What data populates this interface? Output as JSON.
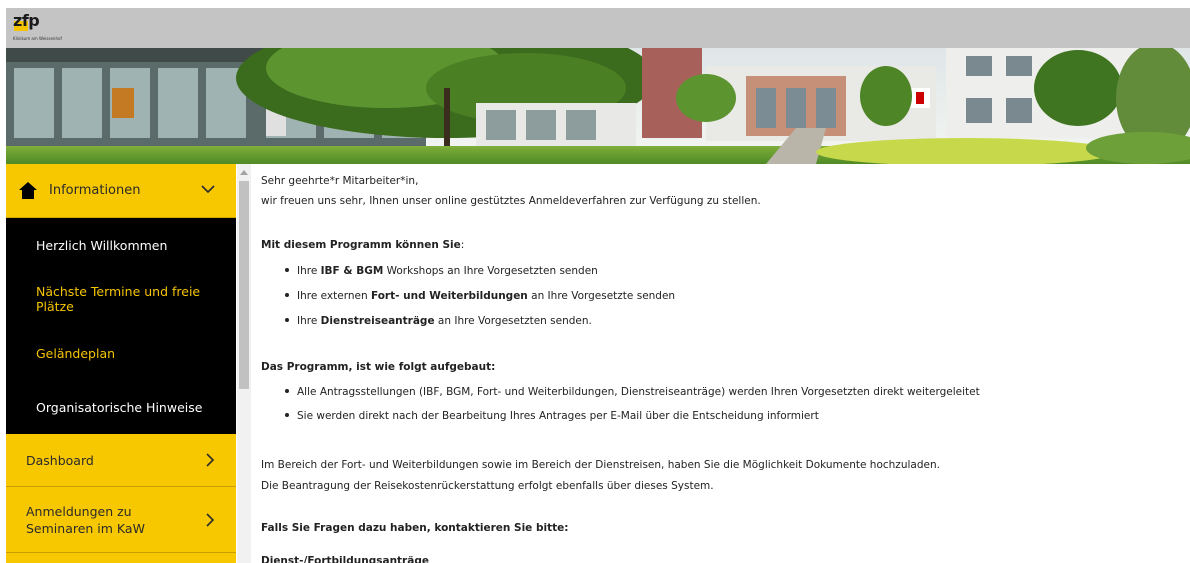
{
  "header": {
    "logo_text": "zfp",
    "logo_subtitle": "Klinikum am Weissenhof"
  },
  "sidebar": {
    "top": {
      "label": "Informationen",
      "icon": "home-icon",
      "chevron": "chevron-down-icon"
    },
    "sub_items": [
      {
        "label": "Herzlich Willkommen",
        "color": "#ffffff"
      },
      {
        "label": "Nächste Termine und freie Plätze",
        "color": "#f5c400"
      },
      {
        "label": "Geländeplan",
        "color": "#f5c400"
      },
      {
        "label": "Organisatorische Hinweise",
        "color": "#ffffff"
      }
    ],
    "items": [
      {
        "label": "Dashboard",
        "chevron": "chevron-right-icon"
      },
      {
        "label": "Anmeldungen zu Seminaren im KaW",
        "chevron": "chevron-right-icon"
      }
    ]
  },
  "content": {
    "greeting": "Sehr geehrte*r Mitarbeiter*in,",
    "intro": "wir freuen uns sehr, Ihnen unser online gestütztes Anmeldeverfahren zur Verfügung zu stellen.",
    "section1_title": "Mit diesem Programm können Sie",
    "section1_colon": ":",
    "section1_items": [
      {
        "pre": "Ihre ",
        "bold": "IBF & BGM",
        "post": " Workshops an Ihre Vorgesetzten senden"
      },
      {
        "pre": "Ihre externen ",
        "bold": "Fort- und Weiterbildungen",
        "post": " an Ihre Vorgesetzte senden"
      },
      {
        "pre": "Ihre ",
        "bold": "Dienstreiseanträge",
        "post": " an Ihre Vorgesetzten senden."
      }
    ],
    "section2_title": "Das Programm, ist wie folgt aufgebaut:",
    "section2_items": [
      "Alle Antragsstellungen (IBF, BGM, Fort- und Weiterbildungen, Dienstreiseanträge) werden Ihren Vorgesetzten direkt weitergeleitet",
      "Sie werden direkt nach der Bearbeitung Ihres Antrages per E-Mail über die Entscheidung informiert"
    ],
    "para1": "Im Bereich der Fort- und Weiterbildungen sowie im Bereich der Dienstreisen, haben Sie die Möglichkeit Dokumente hochzuladen.",
    "para2": "Die Beantragung der Reisekostenrückerstattung erfolgt ebenfalls über dieses System.",
    "contact_title": "Falls Sie Fragen dazu haben, kontaktieren Sie bitte:",
    "contact_sub": "Dienst-/Fortbildungsanträge"
  },
  "colors": {
    "accent": "#f7c700",
    "sidebar_dark": "#000000",
    "topbar": "#c4c4c4"
  }
}
